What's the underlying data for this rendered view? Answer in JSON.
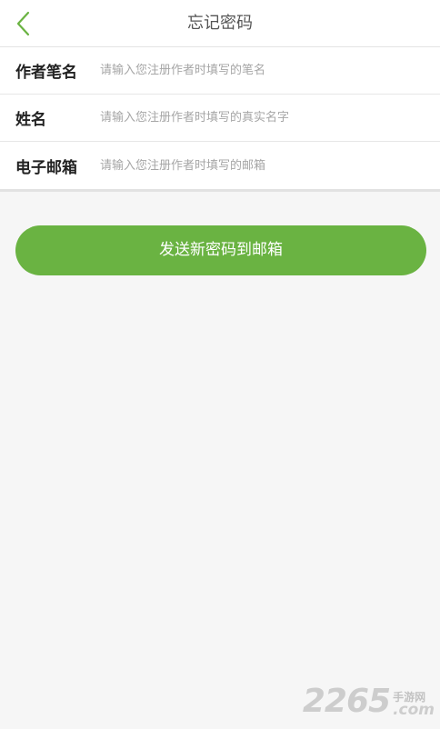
{
  "header": {
    "title": "忘记密码",
    "back_icon": "chevron-left-icon",
    "accent_color": "#6ab342"
  },
  "form": {
    "fields": [
      {
        "label": "作者笔名",
        "placeholder": "请输入您注册作者时填写的笔名",
        "value": ""
      },
      {
        "label": "姓名",
        "placeholder": "请输入您注册作者时填写的真实名字",
        "value": ""
      },
      {
        "label": "电子邮箱",
        "placeholder": "请输入您注册作者时填写的邮箱",
        "value": ""
      }
    ]
  },
  "submit": {
    "label": "发送新密码到邮箱",
    "color": "#6ab342"
  },
  "watermark": {
    "number": "2265",
    "site": "手游网",
    "suffix": ".com"
  }
}
